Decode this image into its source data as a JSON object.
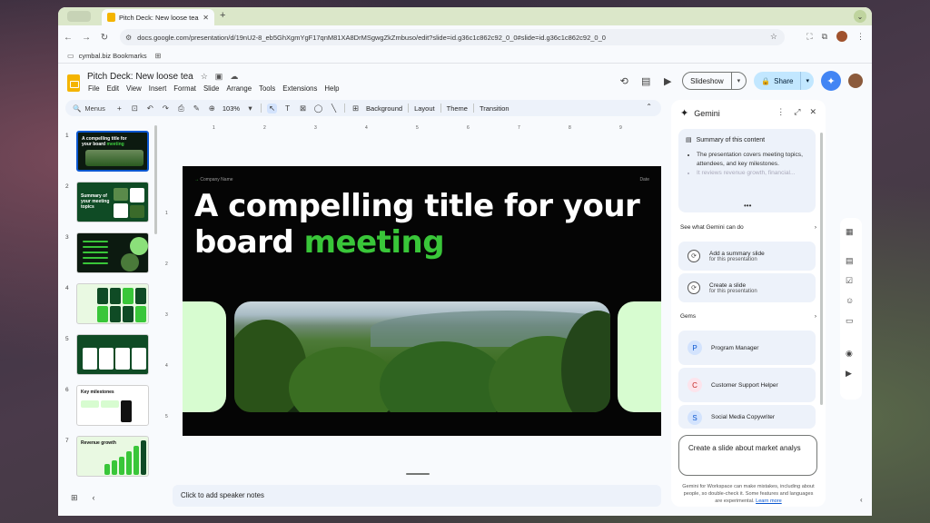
{
  "browser": {
    "tab_title": "Pitch Deck: New loose tea - G",
    "close_glyph": "✕",
    "new_tab_glyph": "+",
    "url": "docs.google.com/presentation/d/19nU2-8_eb5GhXgmYgF17qnM81XA8DrMSgwgZkZmbuso/edit?slide=id.g36c1c862c92_0_0#slide=id.g36c1c862c92_0_0",
    "bookmark": "cymbal.biz Bookmarks"
  },
  "doc": {
    "title": "Pitch Deck: New loose tea",
    "menus": [
      "File",
      "Edit",
      "View",
      "Insert",
      "Format",
      "Slide",
      "Arrange",
      "Tools",
      "Extensions",
      "Help"
    ],
    "slideshow_label": "Slideshow",
    "share_label": "Share"
  },
  "toolbar": {
    "menus_label": "Menus",
    "zoom": "103%",
    "background": "Background",
    "layout": "Layout",
    "theme": "Theme",
    "transition": "Transition"
  },
  "thumbnails": [
    "1",
    "2",
    "3",
    "4",
    "5",
    "6",
    "7"
  ],
  "slide": {
    "company": "Company Name",
    "date": "Date",
    "title_part1": "A compelling title for your board ",
    "title_part2": "meeting"
  },
  "thumb_text": {
    "t1a": "A compelling title for your board ",
    "t1b": "meeting",
    "t2": "Summary of your meeting topics",
    "t6": "Key milestones",
    "t7": "Revenue growth"
  },
  "ruler": {
    "h": [
      "1",
      "2",
      "3",
      "4",
      "5",
      "6",
      "7",
      "8",
      "9"
    ],
    "v": [
      "1",
      "2",
      "3",
      "4",
      "5"
    ]
  },
  "notes_placeholder": "Click to add speaker notes",
  "gemini": {
    "title": "Gemini",
    "summary_title": "Summary of this content",
    "summary_items": [
      "The presentation covers meeting topics, attendees, and key milestones.",
      "It reviews revenue growth, financial..."
    ],
    "see_what": "See what Gemini can do",
    "actions": [
      {
        "title": "Add a summary slide",
        "sub": "for this presentation"
      },
      {
        "title": "Create a slide",
        "sub": "for this presentation"
      }
    ],
    "gems_label": "Gems",
    "gems": [
      {
        "initial": "P",
        "name": "Program Manager",
        "bg": "#d3e3fd",
        "fg": "#0b57d0"
      },
      {
        "initial": "C",
        "name": "Customer Support Helper",
        "bg": "#fce4ec",
        "fg": "#c5221f"
      },
      {
        "initial": "S",
        "name": "Social Media Copywriter",
        "bg": "#d3e3fd",
        "fg": "#0b57d0"
      }
    ],
    "prompt_text": "Create a slide about market analys",
    "disclaimer": "Gemini for Workspace can make mistakes, including about people, so double-check it. Some features and languages are experimental.",
    "learn_more": "Learn more"
  },
  "colors": {
    "accent_green": "#39c639",
    "share_bg": "#c2e7ff",
    "gemini_blue": "#4285f4"
  }
}
